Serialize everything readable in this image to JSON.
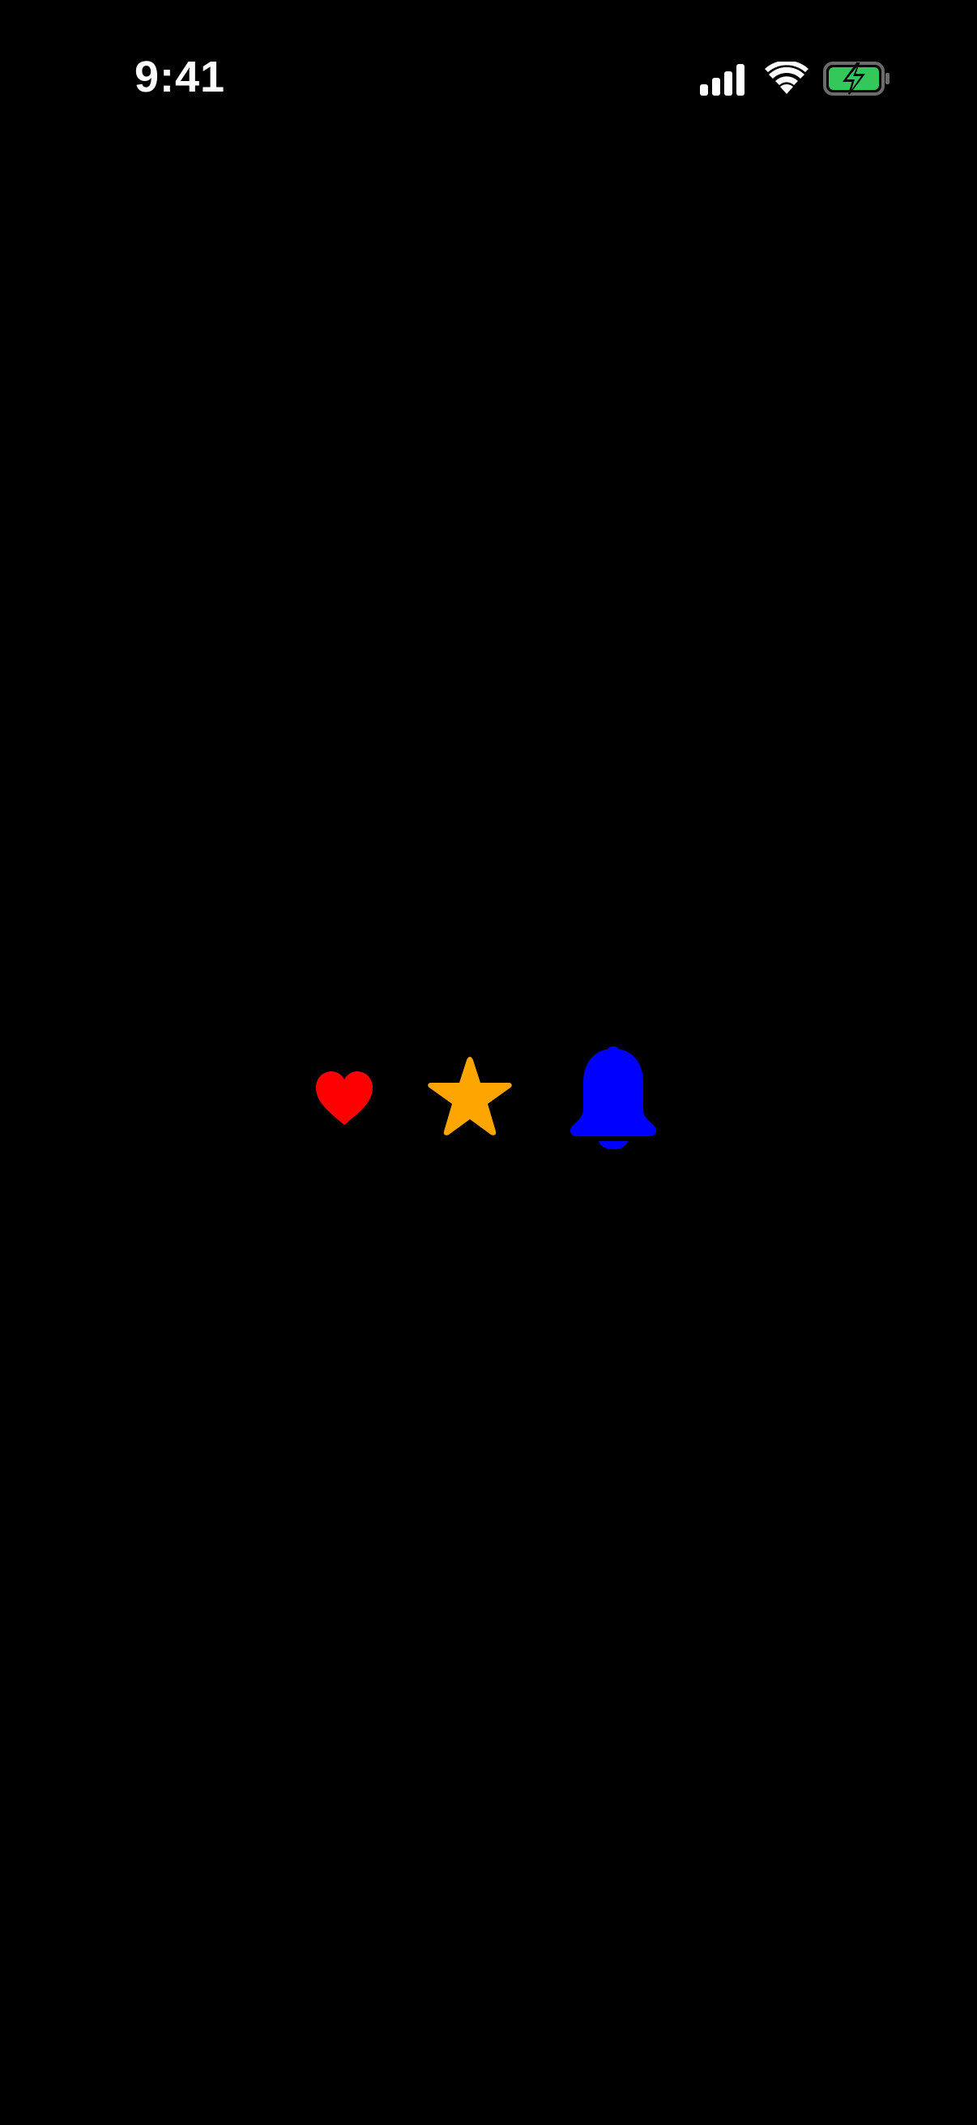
{
  "status_bar": {
    "time": "9:41",
    "signal_icon": "cellular-signal-icon",
    "wifi_icon": "wifi-icon",
    "battery_icon": "battery-charging-icon",
    "battery_color": "#34c759"
  },
  "icons": [
    {
      "name": "heart-icon",
      "color": "#ff0000"
    },
    {
      "name": "star-icon",
      "color": "#ffa500"
    },
    {
      "name": "bell-icon",
      "color": "#0000ff"
    }
  ],
  "background_color": "#000000"
}
